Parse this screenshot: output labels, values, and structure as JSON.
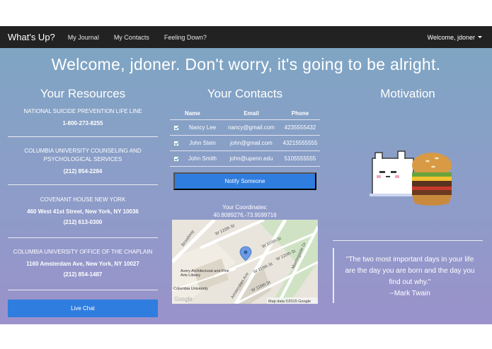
{
  "nav": {
    "brand": "What's Up?",
    "links": [
      "My Journal",
      "My Contacts",
      "Feeling Down?"
    ],
    "user": "Welcome, jdoner"
  },
  "welcome": "Welcome, jdoner. Don't worry, it's going to be alright.",
  "resources": {
    "title": "Your Resources",
    "items": [
      {
        "name": "NATIONAL SUICIDE PREVENTION LIFE LINE",
        "address": "",
        "phone": "1-800-273-8255"
      },
      {
        "name": "COLUMBIA UNIVERSITY COUNSELING AND PSYCHOLOGICAL SERVICES",
        "address": "",
        "phone": "(212) 854-2284"
      },
      {
        "name": "COVENANT HOUSE NEW YORK",
        "address": "460 West 41st Street, New York, NY 10036",
        "phone": "(212) 613-0300"
      },
      {
        "name": "COLUMBIA UNIVERSITY OFFICE OF THE CHAPLAIN",
        "address": "1160 Amsterdam Ave, New York, NY 10027",
        "phone": "(212) 854-1487"
      }
    ],
    "live_chat": "Live Chat"
  },
  "contacts": {
    "title": "Your Contacts",
    "columns": [
      "Name",
      "Email",
      "Phone"
    ],
    "rows": [
      {
        "name": "Nancy Lee",
        "email": "nancy@gmail.com",
        "phone": "4235555432",
        "checked": true
      },
      {
        "name": "John Stein",
        "email": "john@gmail.com",
        "phone": "43215555555",
        "checked": true
      },
      {
        "name": "John Smith",
        "email": "john@upenn.edu",
        "phone": "5105555555",
        "checked": true
      }
    ],
    "notify": "Notify Someone",
    "coords_label": "Your Coordinates:",
    "coords": "40.8089276,-73.9599716",
    "map": {
      "streets": [
        "W 120th St",
        "Broadway",
        "W 119th St",
        "W 120th St",
        "W 118th St",
        "Amsterdam Ave",
        "Morningside Dr",
        "W 119th St"
      ],
      "places": [
        "Avery Architectural and Fine Arts Library",
        "Columbia University"
      ],
      "attribution": "Map data ©2015 Google",
      "logo": "Google"
    }
  },
  "motivation": {
    "title": "Motivation",
    "quote": "\"The two most important days in your life are the day you are born and the day you find out why.\"",
    "author": "--Mark Twain"
  },
  "colors": {
    "accent": "#2f7ddf",
    "navbar": "#222222",
    "bg_top": "#7fa5c3",
    "bg_bottom": "#9a92cb"
  }
}
